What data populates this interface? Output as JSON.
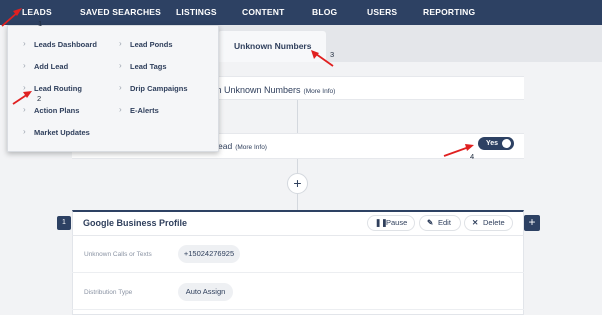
{
  "nav": {
    "items": [
      "LEADS",
      "SAVED SEARCHES",
      "LISTINGS",
      "CONTENT",
      "BLOG",
      "USERS",
      "REPORTING"
    ]
  },
  "tabs": {
    "active_label": "Unknown Numbers"
  },
  "rule": {
    "title_visible": "m Unknown Numbers",
    "more_info": "(More Info)"
  },
  "row2": {
    "title_visible": "ead",
    "more_info": "(More Info)",
    "toggle_label": "Yes"
  },
  "add_symbol": "+",
  "card": {
    "index": "1",
    "title": "Google Business Profile",
    "actions": {
      "pause": "Pause",
      "edit": "Edit",
      "delete": "Delete"
    },
    "fields": [
      {
        "label": "Unknown Calls or Texts",
        "value": "+15024276925"
      },
      {
        "label": "Distribution Type",
        "value": "Auto Assign"
      }
    ]
  },
  "leads_menu": {
    "left": [
      "Leads Dashboard",
      "Add Lead",
      "Lead Routing",
      "Action Plans",
      "Market Updates"
    ],
    "right": [
      "Lead Ponds",
      "Lead Tags",
      "Drip Campaigns",
      "E-Alerts"
    ]
  },
  "annotations": [
    "1",
    "2",
    "3",
    "4"
  ],
  "colors": {
    "nav_bg": "#2d4163",
    "arrow": "#e02020",
    "accent": "#2d4163"
  }
}
